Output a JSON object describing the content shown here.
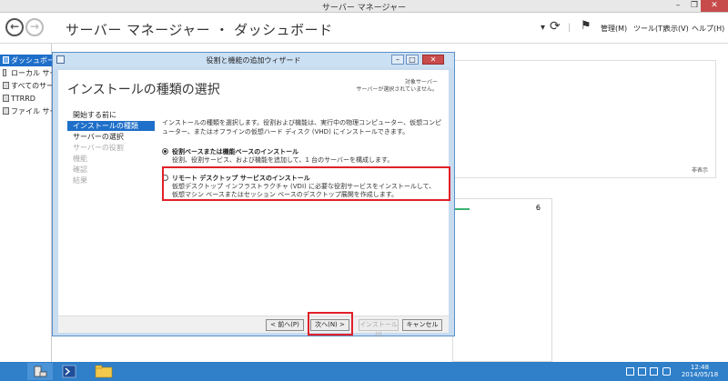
{
  "server_manager": {
    "window_title": "サーバー マネージャー",
    "breadcrumb": "サーバー マネージャー ・ ダッシュボード",
    "menus": [
      "管理(M)",
      "ツール(T)",
      "表示(V)",
      "ヘルプ(H)"
    ],
    "sidebar": [
      {
        "label": "ダッシュボード",
        "active": true
      },
      {
        "label": "ローカル サーバー",
        "active": false
      },
      {
        "label": "すべてのサーバー",
        "active": false
      },
      {
        "label": "TTRRD",
        "active": false
      },
      {
        "label": "ファイル サービス",
        "active": false
      }
    ],
    "hide_link": "非表示",
    "tile_count": "6"
  },
  "wizard": {
    "title": "役割と機能の追加ウィザード",
    "heading": "インストールの種類の選択",
    "target_server_label": "対象サーバー",
    "target_server_value": "サーバーが選択されていません。",
    "nav": [
      {
        "label": "開始する前に",
        "state": "normal"
      },
      {
        "label": "インストールの種類",
        "state": "active"
      },
      {
        "label": "サーバーの選択",
        "state": "normal"
      },
      {
        "label": "サーバーの役割",
        "state": "disabled"
      },
      {
        "label": "機能",
        "state": "disabled"
      },
      {
        "label": "確認",
        "state": "disabled"
      },
      {
        "label": "結果",
        "state": "disabled"
      }
    ],
    "description": "インストールの種類を選択します。役割および機能は、実行中の物理コンピューター、仮想コンピューター、またはオフラインの仮想ハード ディスク (VHD) にインストールできます。",
    "options": [
      {
        "label": "役割ベースまたは機能ベースのインストール",
        "desc": "役割、役割サービス、および機能を追加して、1 台のサーバーを構成します。",
        "checked": true
      },
      {
        "label": "リモート デスクトップ サービスのインストール",
        "desc": "仮想デスクトップ インフラストラクチャ (VDI) に必要な役割サービスをインストールして、仮想マシン ベースまたはセッション ベースのデスクトップ展開を作成します。",
        "checked": false
      }
    ],
    "buttons": {
      "prev": "< 前へ(P)",
      "next": "次へ(N) >",
      "install": "インストール(I)",
      "cancel": "キャンセル"
    }
  },
  "taskbar": {
    "time": "12:48",
    "date": "2014/05/18"
  }
}
